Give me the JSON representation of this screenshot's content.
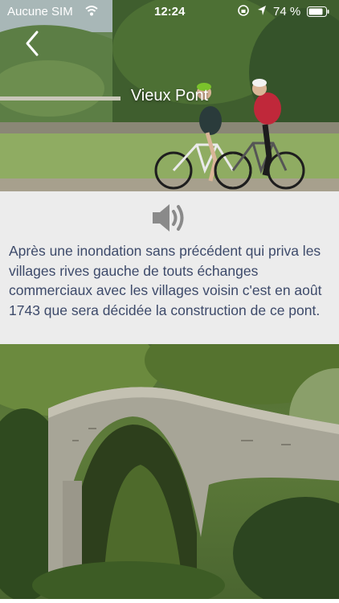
{
  "status_bar": {
    "carrier": "Aucune SIM",
    "time": "12:24",
    "battery_percent": "74 %",
    "icons": [
      "wifi-icon",
      "lock-rotation-icon",
      "location-icon",
      "battery-icon"
    ]
  },
  "header": {
    "title": "Vieux Pont",
    "back_icon": "chevron-left-icon"
  },
  "audio": {
    "icon": "speaker-icon"
  },
  "description": "Après une inondation sans précédent qui priva les villages rives gauche de touts échanges commerciaux avec les villages voisin c'est en août 1743 que sera décidée la construction de ce pont.",
  "colors": {
    "panel_background": "#ececec",
    "text": "#3d4a6a",
    "icon_gray": "#8a8a8a"
  }
}
